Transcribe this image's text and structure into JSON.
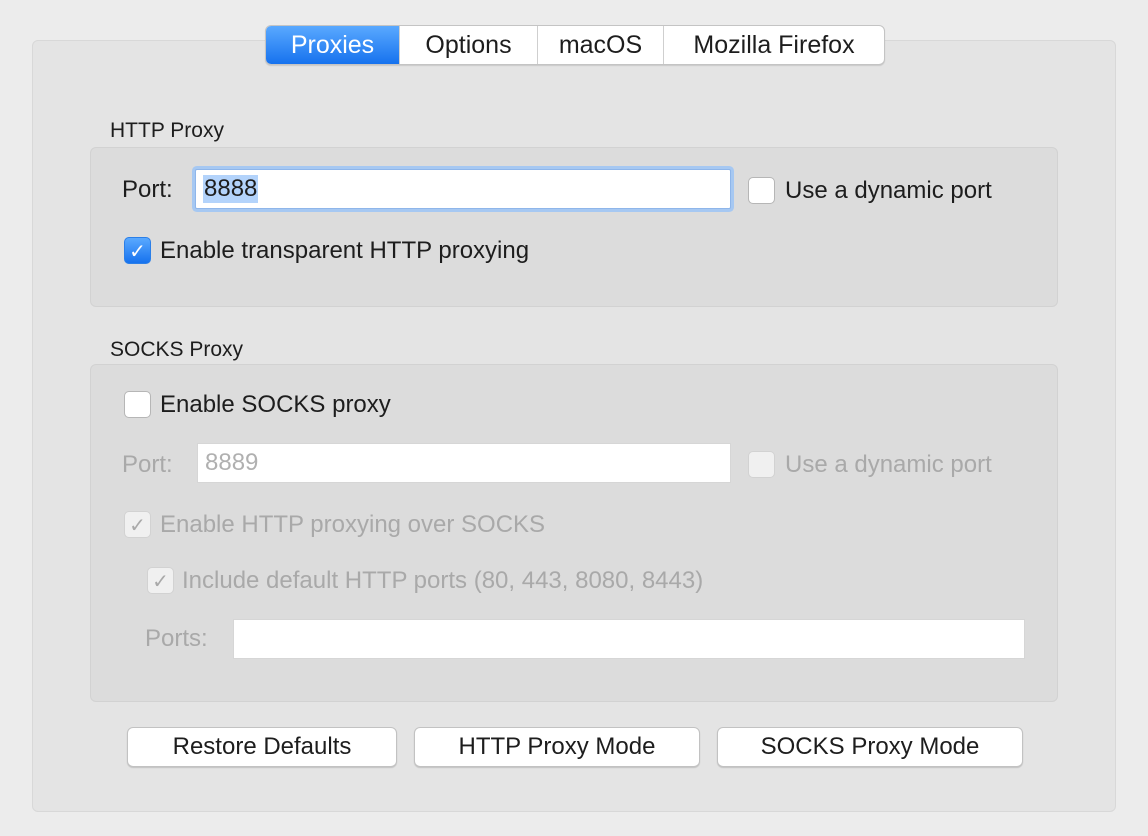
{
  "tabs": [
    {
      "label": "Proxies",
      "active": true
    },
    {
      "label": "Options",
      "active": false
    },
    {
      "label": "macOS",
      "active": false
    },
    {
      "label": "Mozilla Firefox",
      "active": false
    }
  ],
  "http_proxy": {
    "title": "HTTP Proxy",
    "port_label": "Port:",
    "port_value": "8888",
    "dynamic_port_label": "Use a dynamic port",
    "dynamic_port_checked": false,
    "transparent_label": "Enable transparent HTTP proxying",
    "transparent_checked": true
  },
  "socks_proxy": {
    "title": "SOCKS Proxy",
    "enable_label": "Enable SOCKS proxy",
    "enable_checked": false,
    "port_label": "Port:",
    "port_placeholder": "8889",
    "dynamic_port_label": "Use a dynamic port",
    "http_over_socks_label": "Enable HTTP proxying over SOCKS",
    "http_over_socks_checked": true,
    "include_default_ports_label": "Include default HTTP ports (80, 443, 8080, 8443)",
    "include_default_ports_checked": true,
    "ports_label": "Ports:",
    "ports_value": ""
  },
  "buttons": {
    "restore": "Restore Defaults",
    "http_mode": "HTTP Proxy Mode",
    "socks_mode": "SOCKS Proxy Mode"
  },
  "icons": {
    "checkmark": "checkmark-icon"
  },
  "colors": {
    "accent": "#1672ee",
    "disabled_text": "#a9a9a9"
  }
}
